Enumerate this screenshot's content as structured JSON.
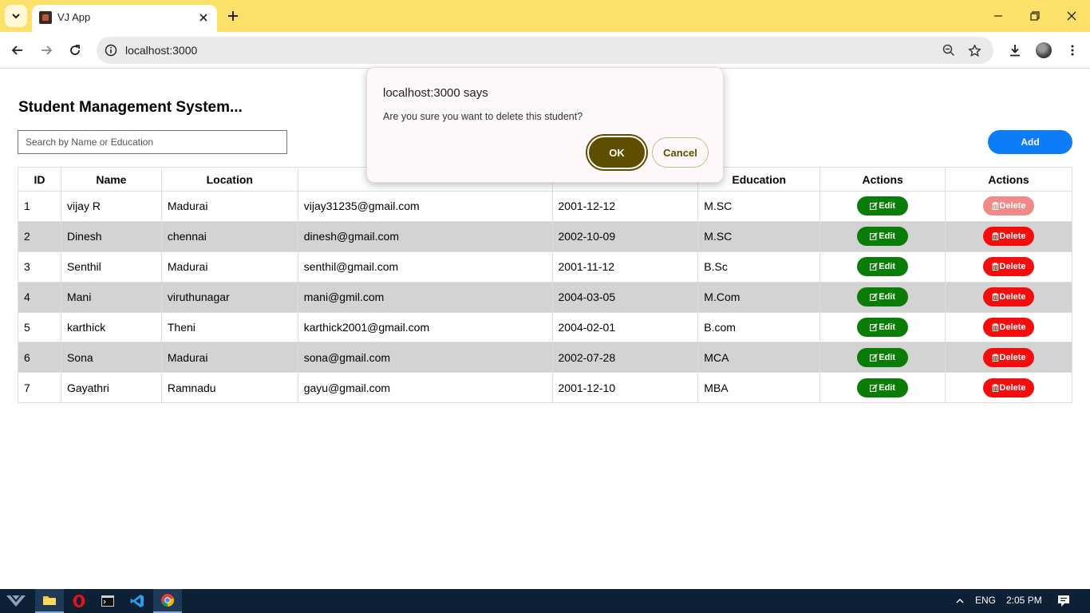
{
  "browser": {
    "tab_title": "VJ App",
    "url": "localhost:3000"
  },
  "page": {
    "title": "Student Management System...",
    "search_placeholder": "Search by Name or Education",
    "add_label": "Add"
  },
  "table": {
    "headers": [
      "ID",
      "Name",
      "Location",
      "",
      "",
      "Education",
      "Actions",
      "Actions"
    ],
    "edit_label": "Edit",
    "delete_label": "Delete",
    "rows": [
      {
        "id": "1",
        "name": "vijay R",
        "location": "Madurai",
        "email": "vijay31235@gmail.com",
        "dob": "2001-12-12",
        "education": "M.SC"
      },
      {
        "id": "2",
        "name": "Dinesh",
        "location": "chennai",
        "email": "dinesh@gmail.com",
        "dob": "2002-10-09",
        "education": "M.SC"
      },
      {
        "id": "3",
        "name": "Senthil",
        "location": "Madurai",
        "email": "senthil@gmail.com",
        "dob": "2001-11-12",
        "education": "B.Sc"
      },
      {
        "id": "4",
        "name": "Mani",
        "location": "viruthunagar",
        "email": "mani@gmil.com",
        "dob": "2004-03-05",
        "education": "M.Com"
      },
      {
        "id": "5",
        "name": "karthick",
        "location": "Theni",
        "email": "karthick2001@gmail.com",
        "dob": "2004-02-01",
        "education": "B.com"
      },
      {
        "id": "6",
        "name": "Sona",
        "location": "Madurai",
        "email": "sona@gmail.com",
        "dob": "2002-07-28",
        "education": "MCA"
      },
      {
        "id": "7",
        "name": "Gayathri",
        "location": "Ramnadu",
        "email": "gayu@gmail.com",
        "dob": "2001-12-10",
        "education": "MBA"
      }
    ]
  },
  "dialog": {
    "title": "localhost:3000 says",
    "message": "Are you sure you want to delete this student?",
    "ok_label": "OK",
    "cancel_label": "Cancel"
  },
  "taskbar": {
    "language": "ENG",
    "time": "2:05 PM"
  },
  "colors": {
    "tabstrip": "#fde16b",
    "add_button": "#0d7cf7",
    "edit_button": "#0a7d07",
    "delete_button": "#f40d0d",
    "ok_button": "#5e4f00",
    "taskbar": "#0d2035"
  }
}
